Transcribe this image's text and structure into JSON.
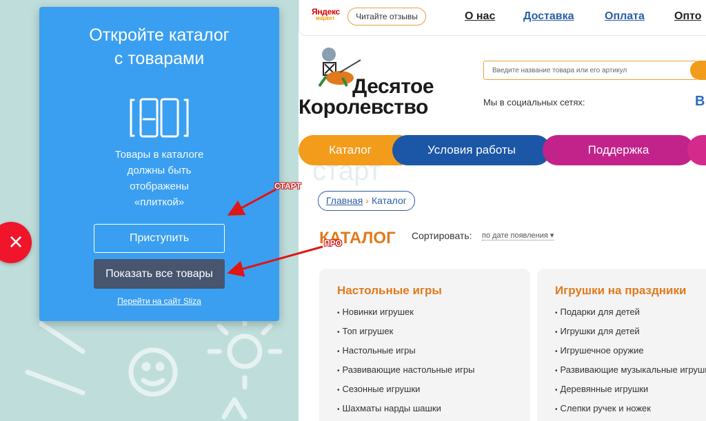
{
  "site": {
    "market_badge": {
      "line1": "Яндекс",
      "line2": "маркет"
    },
    "reviews_button": "Читайте отзывы",
    "top_links": [
      "О нас",
      "Доставка",
      "Оплата",
      "Опто"
    ],
    "logo": {
      "line1": "Десятое",
      "line2": "Королевство"
    },
    "search_placeholder": "Введите название товара или его артикул",
    "social_label": "Мы в социальных сетях:",
    "social_vk": "В",
    "nav": [
      {
        "label": "Каталог",
        "color": "#f39c1c"
      },
      {
        "label": "Условия работы",
        "color": "#1b57a6"
      },
      {
        "label": "Поддержка",
        "color": "#c2238a"
      },
      {
        "label": "",
        "color": "#d42a8c"
      }
    ],
    "watermark": "старт",
    "breadcrumb": {
      "home": "Главная",
      "sep": "›",
      "current": "Каталог"
    },
    "catalog_title": "КАТАЛОГ",
    "sort": {
      "label": "Сортировать:",
      "value": "по дате появления"
    },
    "cards": [
      {
        "title": "Настольные игры",
        "items": [
          "Новинки игрушек",
          "Топ игрушек",
          "Настольные игры",
          "Развивающие настольные игры",
          "Сезонные игрушки",
          "Шахматы нарды шашки"
        ]
      },
      {
        "title": "Игрушки на праздники",
        "items": [
          "Подарки для детей",
          "Игрушки для детей",
          "Игрушечное оружие",
          "Развивающие музыкальные игрушки",
          "Деревянные игрушки",
          "Слепки ручек и ножек"
        ]
      }
    ]
  },
  "modal": {
    "title_line1": "Откройте каталог",
    "title_line2": "с товарами",
    "desc_lines": [
      "Товары в каталоге",
      "должны быть",
      "отображены",
      "«плиткой»"
    ],
    "start_button": "Приступить",
    "all_goods_button": "Показать все товары",
    "site_link": "Перейти на сайт Sliza",
    "close_icon": "×",
    "accent": "#3a9ff0"
  },
  "annotations": {
    "start": "СТАРТ",
    "pro": "ПРО"
  }
}
